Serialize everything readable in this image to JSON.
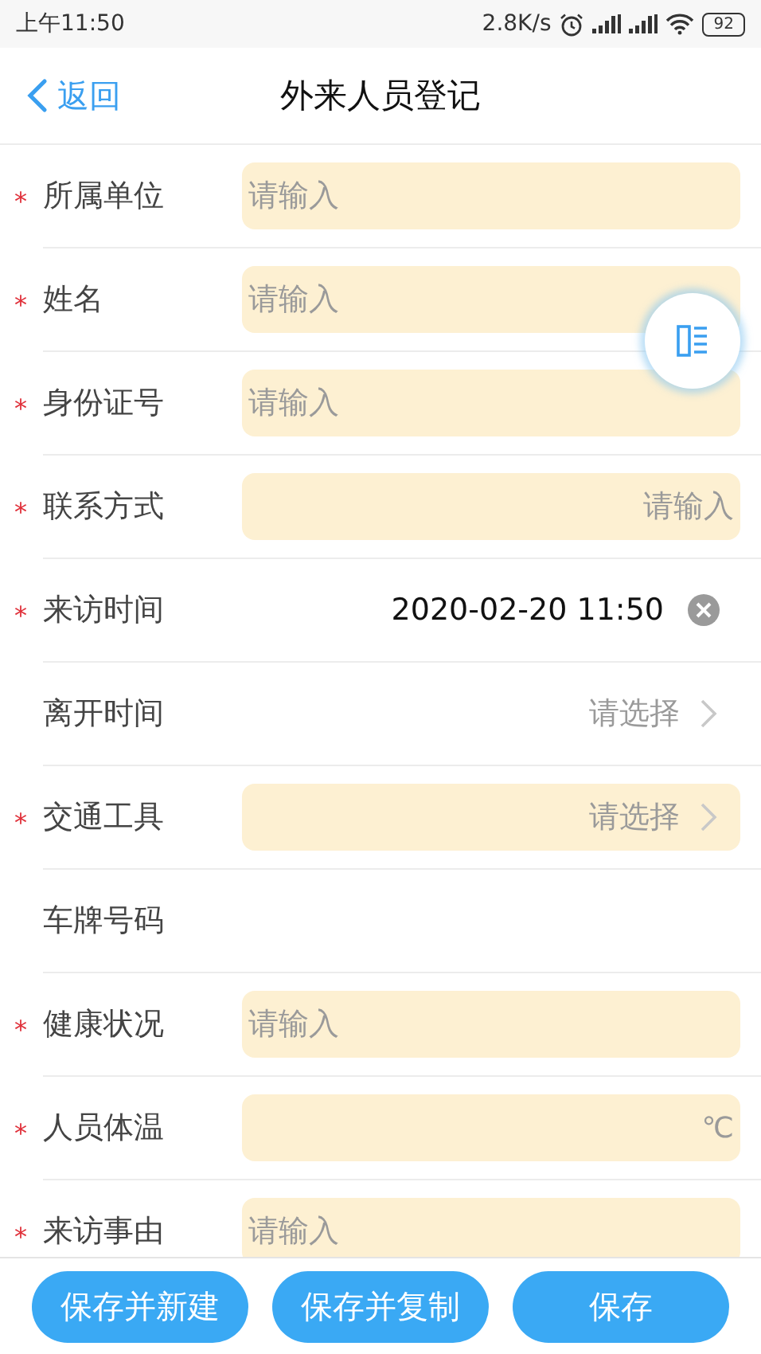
{
  "status_bar": {
    "time": "上午11:50",
    "speed": "2.8K/s",
    "battery": "92"
  },
  "header": {
    "back": "返回",
    "title": "外来人员登记"
  },
  "required_mark": "*",
  "rows": [
    {
      "label": "所属单位",
      "required": true,
      "kind": "input",
      "highlighted": true,
      "placeholder": "请输入"
    },
    {
      "label": "姓名",
      "required": true,
      "kind": "input",
      "highlighted": true,
      "placeholder": "请输入"
    },
    {
      "label": "身份证号",
      "required": true,
      "kind": "input",
      "highlighted": true,
      "placeholder": "请输入"
    },
    {
      "label": "联系方式",
      "required": true,
      "kind": "input-end",
      "highlighted": true,
      "placeholder": "请输入"
    },
    {
      "label": "来访时间",
      "required": true,
      "kind": "datetime",
      "highlighted": false,
      "value": "2020-02-20 11:50"
    },
    {
      "label": "离开时间",
      "required": false,
      "kind": "select",
      "highlighted": false,
      "placeholder": "请选择"
    },
    {
      "label": "交通工具",
      "required": true,
      "kind": "select",
      "highlighted": true,
      "placeholder": "请选择"
    },
    {
      "label": "车牌号码",
      "required": false,
      "kind": "empty",
      "highlighted": false
    },
    {
      "label": "健康状况",
      "required": true,
      "kind": "input",
      "highlighted": true,
      "placeholder": "请输入"
    },
    {
      "label": "人员体温",
      "required": true,
      "kind": "unit",
      "highlighted": true,
      "unit": "℃"
    },
    {
      "label": "来访事由",
      "required": true,
      "kind": "input",
      "highlighted": true,
      "placeholder": "请输入"
    }
  ],
  "buttons": [
    "保存并新建",
    "保存并复制",
    "保存"
  ]
}
